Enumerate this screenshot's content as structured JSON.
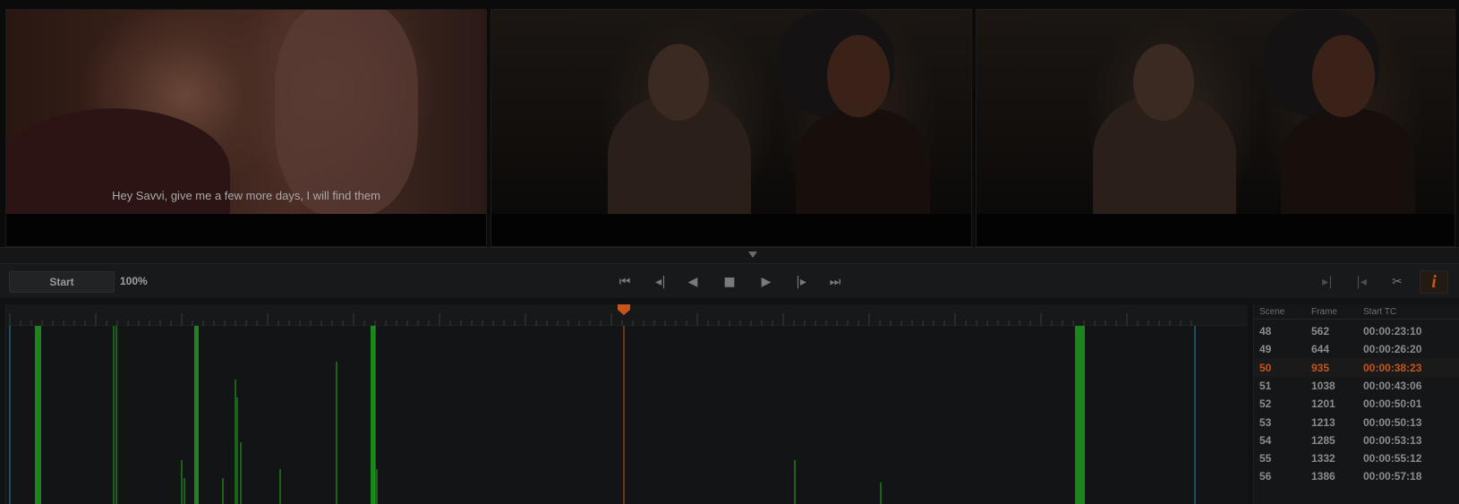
{
  "viewers": {
    "left": {
      "subtitle": "Hey Savvi, give me a few more days, I will find them"
    },
    "center": {},
    "right": {}
  },
  "transport": {
    "start_label": "Start",
    "zoom": "100%",
    "controls": [
      "skip-to-start",
      "step-back",
      "play-reverse",
      "stop",
      "play",
      "step-forward",
      "skip-to-end"
    ],
    "right_controls": [
      "mark-in",
      "mark-out",
      "scissors",
      "info"
    ],
    "info_label": "i"
  },
  "timeline": {
    "accent_color": "#c4561c",
    "cut_color": "#1f9a1f"
  },
  "scene_list": {
    "headers": {
      "scene": "Scene",
      "frame": "Frame",
      "start_tc": "Start TC"
    },
    "rows": [
      {
        "scene": "48",
        "frame": "562",
        "start_tc": "00:00:23:10"
      },
      {
        "scene": "49",
        "frame": "644",
        "start_tc": "00:00:26:20"
      },
      {
        "scene": "50",
        "frame": "935",
        "start_tc": "00:00:38:23",
        "selected": true
      },
      {
        "scene": "51",
        "frame": "1038",
        "start_tc": "00:00:43:06"
      },
      {
        "scene": "52",
        "frame": "1201",
        "start_tc": "00:00:50:01"
      },
      {
        "scene": "53",
        "frame": "1213",
        "start_tc": "00:00:50:13"
      },
      {
        "scene": "54",
        "frame": "1285",
        "start_tc": "00:00:53:13"
      },
      {
        "scene": "55",
        "frame": "1332",
        "start_tc": "00:00:55:12"
      },
      {
        "scene": "56",
        "frame": "1386",
        "start_tc": "00:00:57:18"
      }
    ]
  },
  "colors": {
    "accent": "#c4561c",
    "cut_marker": "#1f9a1f",
    "playhead": "#c4561c"
  }
}
